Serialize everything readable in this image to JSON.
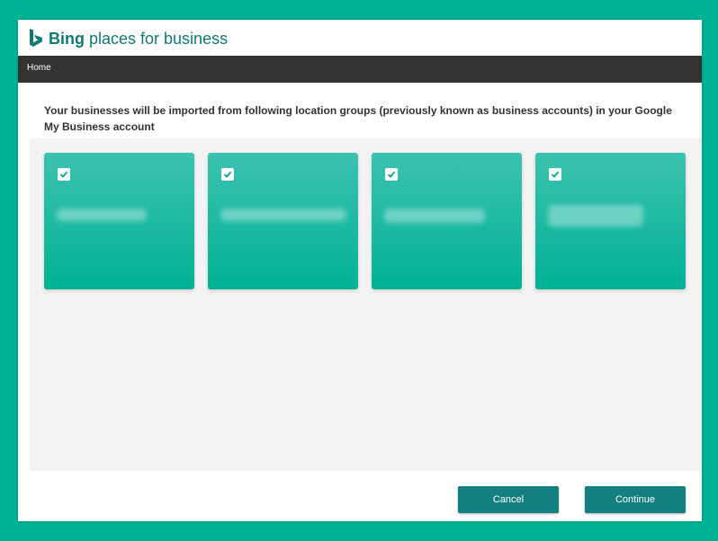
{
  "brand": {
    "bold": "Bing",
    "rest": "places for business",
    "logo_icon": "bing-logo-icon",
    "color": "#0f7a73"
  },
  "nav": {
    "home_label": "Home"
  },
  "notice": {
    "text": "Your businesses will be imported from following location groups (previously known as business accounts) in your Google My Business account"
  },
  "cards": [
    {
      "checked": true,
      "name": ""
    },
    {
      "checked": true,
      "name": ""
    },
    {
      "checked": true,
      "name": ""
    },
    {
      "checked": true,
      "name": ""
    }
  ],
  "buttons": {
    "cancel": "Cancel",
    "continue": "Continue"
  },
  "colors": {
    "background": "#00b294",
    "card": "#00b294",
    "button": "#137f7f",
    "navbar": "#333333"
  }
}
